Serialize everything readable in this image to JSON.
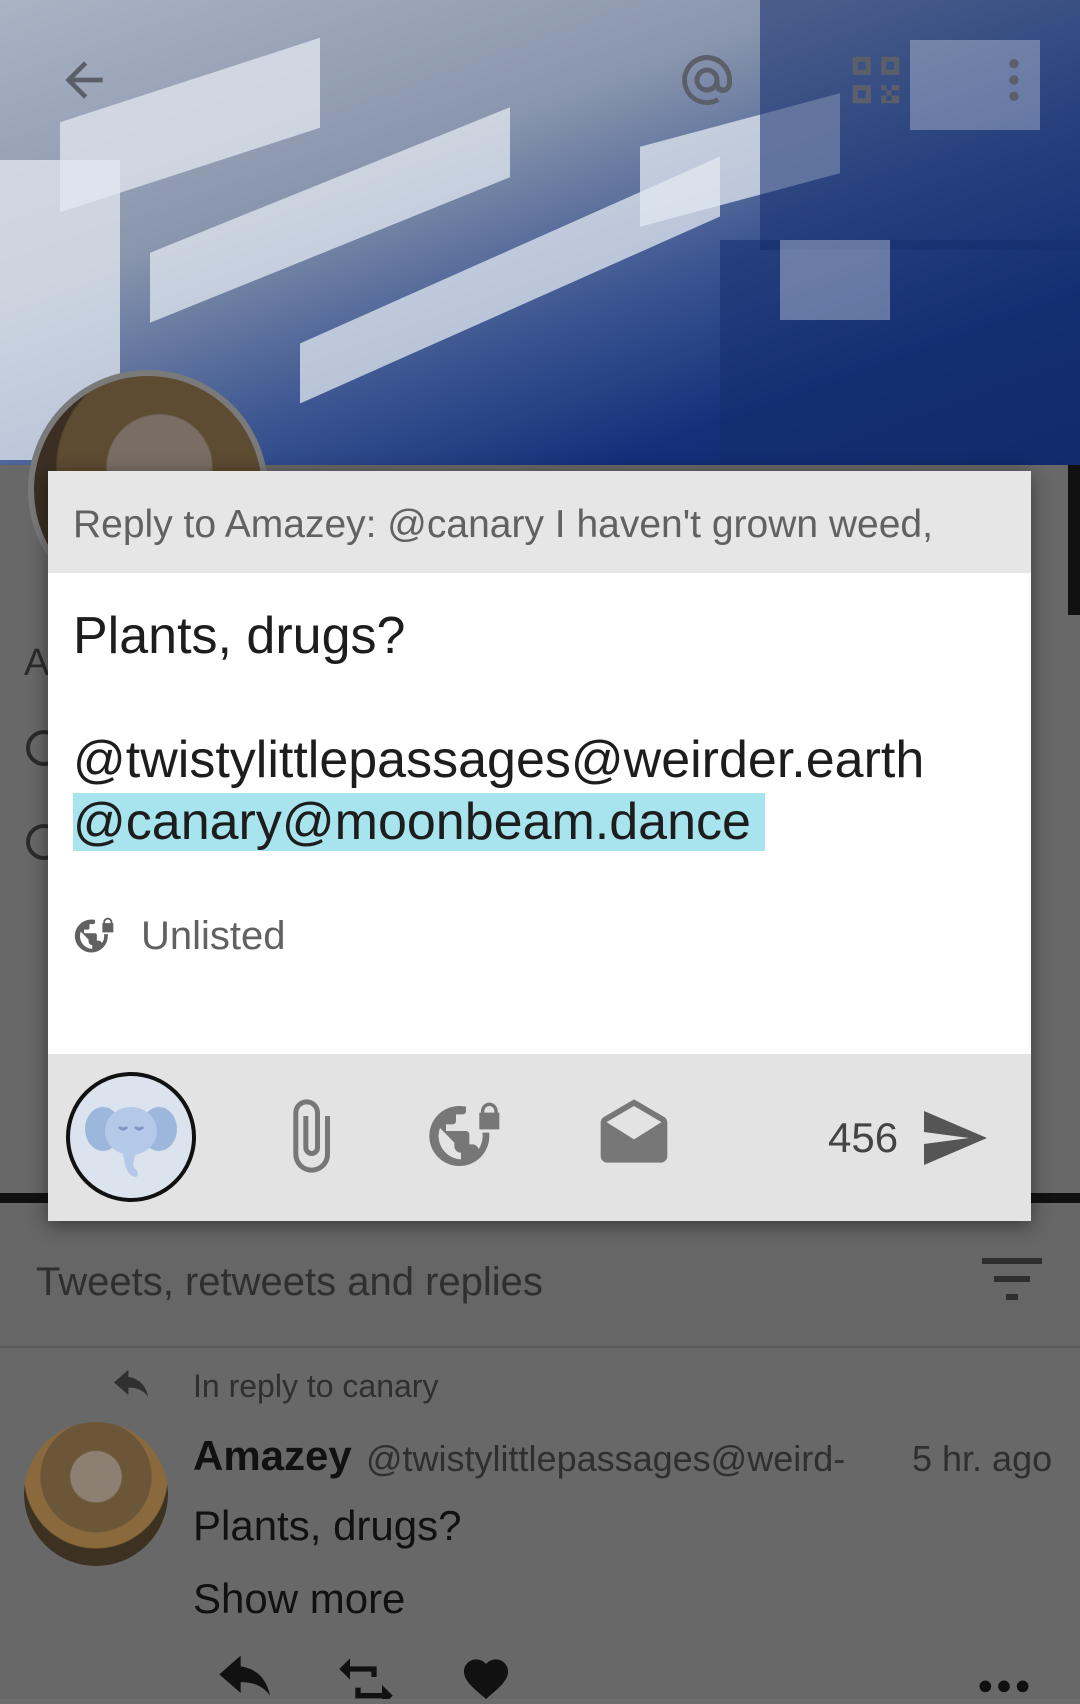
{
  "profile": {
    "tabs_label": "Tweets, retweets and replies",
    "ghost_initial": "A"
  },
  "feed": {
    "reply_line": "In reply to canary",
    "post": {
      "name": "Amazey",
      "handle": "@twistylittlepassages@weird-",
      "time": "5 hr. ago",
      "text": "Plants, drugs?",
      "show_more": "Show more"
    }
  },
  "dialog": {
    "reply_to": "Reply to Amazey: @canary I haven't grown weed,",
    "compose_lines": [
      "Plants, drugs?",
      "",
      "@twistylittlepassages@weirder.earth",
      "@canary@moonbeam.dance"
    ],
    "visibility": "Unlisted",
    "char_count": "456"
  },
  "icons": {
    "back": "back-arrow-icon",
    "mention": "at-sign-icon",
    "qr": "qr-code-icon",
    "overflow": "more-vert-icon",
    "attach": "paperclip-icon",
    "visibility": "globe-lock-icon",
    "dm": "envelope-open-icon",
    "send": "send-icon"
  },
  "colors": {
    "selection": "#a8e4ed",
    "dialog_header": "#e6e6e6",
    "toolbar": "#e3e3e3",
    "overlay_page": "#686868"
  }
}
